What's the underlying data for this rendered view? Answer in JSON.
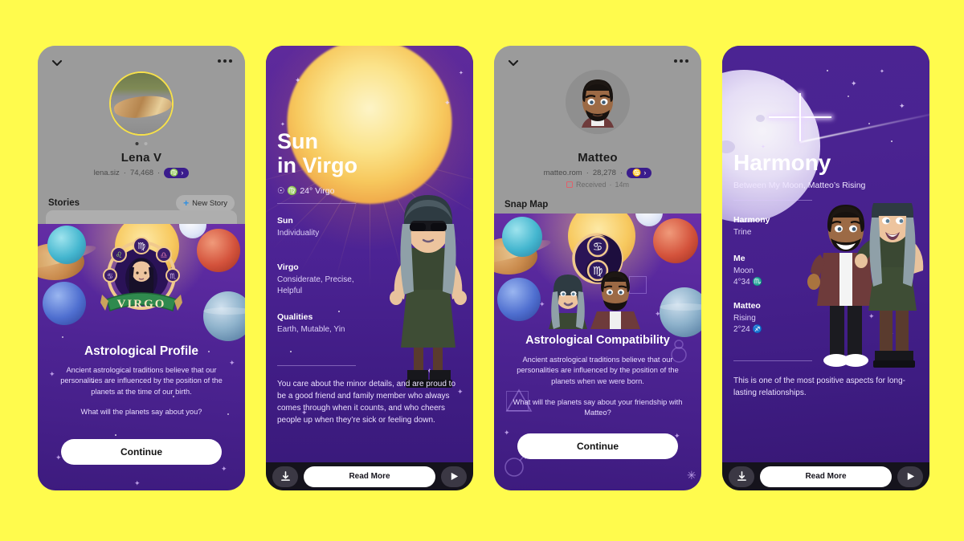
{
  "background_color": "#FFFB4D",
  "screens": [
    {
      "id": "profile-lena",
      "type": "snapchat-profile",
      "nav": {
        "back_icon": "chevron-down-icon",
        "more_icon": "more-options-icon"
      },
      "avatar": {
        "name": "avatar",
        "ring_color": "#F7E14A"
      },
      "pager_dots": 2,
      "display_name": "Lena V",
      "username": "lena.siz",
      "snapscore": "74,468",
      "zodiac_badge": {
        "glyph": "♍",
        "sign": "Virgo",
        "chevron": "›",
        "color": "#3A1C8C"
      },
      "section_title": "Stories",
      "new_story_button": "New Story",
      "overlay_card": {
        "emblem_sign": "VIRGO",
        "emblem_glyph": "♍",
        "title": "Astrological Profile",
        "body": "Ancient astrological traditions believe that our personalities are influenced by the position of the planets at the time of our birth.",
        "question": "What will the planets say about you?",
        "cta": "Continue"
      }
    },
    {
      "id": "sun-in-virgo",
      "type": "astro-detail",
      "title_line1": "Sun",
      "title_line2": "in Virgo",
      "position_line": "☉ ♍ 24° Virgo",
      "position_planet_glyph": "☉",
      "position_sign_glyph": "♍",
      "position_degrees": "24°",
      "position_sign": "Virgo",
      "blocks": [
        {
          "label": "Sun",
          "value": "Individuality"
        },
        {
          "label": "Virgo",
          "value": "Considerate, Precise, Helpful"
        },
        {
          "label": "Qualities",
          "value": "Earth, Mutable, Yin"
        }
      ],
      "paragraph": "You care about the minor details, and are proud to be a good friend and family member who always comes through when it counts, and who cheers people up when they’re sick or feeling down.",
      "bottom_bar": {
        "download_icon": "download-icon",
        "read_more": "Read More",
        "send_icon": "send-icon"
      }
    },
    {
      "id": "profile-matteo",
      "type": "snapchat-profile",
      "nav": {
        "back_icon": "chevron-down-icon",
        "more_icon": "more-options-icon"
      },
      "avatar": {
        "name": "bitmoji-avatar"
      },
      "display_name": "Matteo",
      "username": "matteo.rom",
      "snapscore": "28,278",
      "zodiac_badge": {
        "glyph": "♋",
        "sign": "Cancer",
        "chevron": "›",
        "color": "#3A1C8C"
      },
      "status": {
        "icon": "received-snap-icon",
        "label": "Received",
        "time": "14m"
      },
      "section_title": "Snap Map",
      "overlay_card": {
        "emblem_glyph_left": "♍",
        "emblem_glyph_right": "♋",
        "title": "Astrological Compatibility",
        "body": "Ancient astrological traditions believe that our personalities are influenced by the position of the planets when we were born.",
        "question": "What will the planets say about your friendship with Matteo?",
        "cta": "Continue"
      }
    },
    {
      "id": "harmony",
      "type": "astro-detail",
      "title_line1": "Harmony",
      "subtitle": "Between My Moon, Matteo’s Rising",
      "blocks": [
        {
          "label": "Harmony",
          "value": "Trine"
        },
        {
          "label": "Me",
          "value": "Moon",
          "degree": "4°34",
          "sign_glyph": "♏"
        },
        {
          "label": "Matteo",
          "value": "Rising",
          "degree": "2°24",
          "sign_glyph": "♐"
        }
      ],
      "paragraph": "This is one of the most positive aspects for long-lasting relationships.",
      "bottom_bar": {
        "download_icon": "download-icon",
        "read_more": "Read More",
        "send_icon": "send-icon"
      }
    }
  ]
}
